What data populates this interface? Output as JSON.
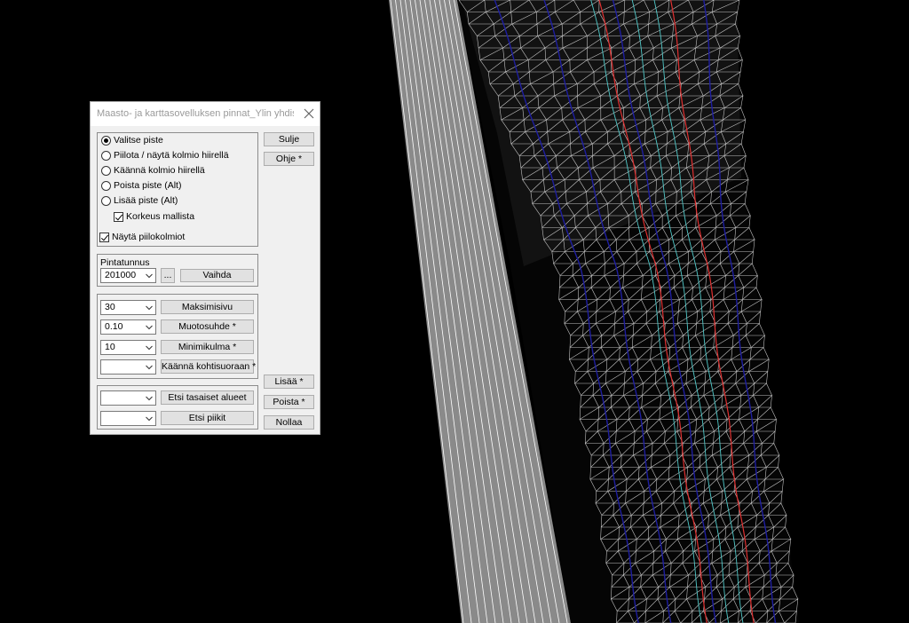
{
  "dialog": {
    "title": "Maasto- ja karttasovelluksen pinnat_Ylin yhdis...",
    "mode_options": [
      {
        "label": "Valitse piste",
        "selected": true
      },
      {
        "label": "Piilota / näytä kolmio hiirellä",
        "selected": false
      },
      {
        "label": "Käännä kolmio hiirellä",
        "selected": false
      },
      {
        "label": "Poista piste (Alt)",
        "selected": false
      },
      {
        "label": "Lisää piste (Alt)",
        "selected": false
      }
    ],
    "height_from_model": {
      "label": "Korkeus mallista",
      "checked": true
    },
    "show_hidden": {
      "label": "Näytä piilokolmiot",
      "checked": true
    },
    "surface": {
      "group_label": "Pintatunnus",
      "value": "201000",
      "browse_label": "...",
      "change_label": "Vaihda"
    },
    "params": [
      {
        "value": "30",
        "button": "Maksimisivu"
      },
      {
        "value": "0.10",
        "button": "Muotosuhde *"
      },
      {
        "value": "10",
        "button": "Minimikulma *"
      },
      {
        "value": "",
        "button": "Käännä kohtisuoraan *"
      }
    ],
    "search": [
      {
        "value": "",
        "button": "Etsi tasaiset alueet"
      },
      {
        "value": "",
        "button": "Etsi piikit"
      }
    ],
    "side_buttons": {
      "close": "Sulje",
      "help": "Ohje *",
      "add": "Lisää *",
      "remove": "Poista *",
      "reset": "Nollaa"
    }
  },
  "colors": {
    "background": "#000000",
    "surface_fill": "#8c8c8c",
    "mesh_lines": "#ffffff",
    "breaklines": "#1e1ea0",
    "centerline": "#e03030",
    "accent_lines": "#50c8c8"
  }
}
